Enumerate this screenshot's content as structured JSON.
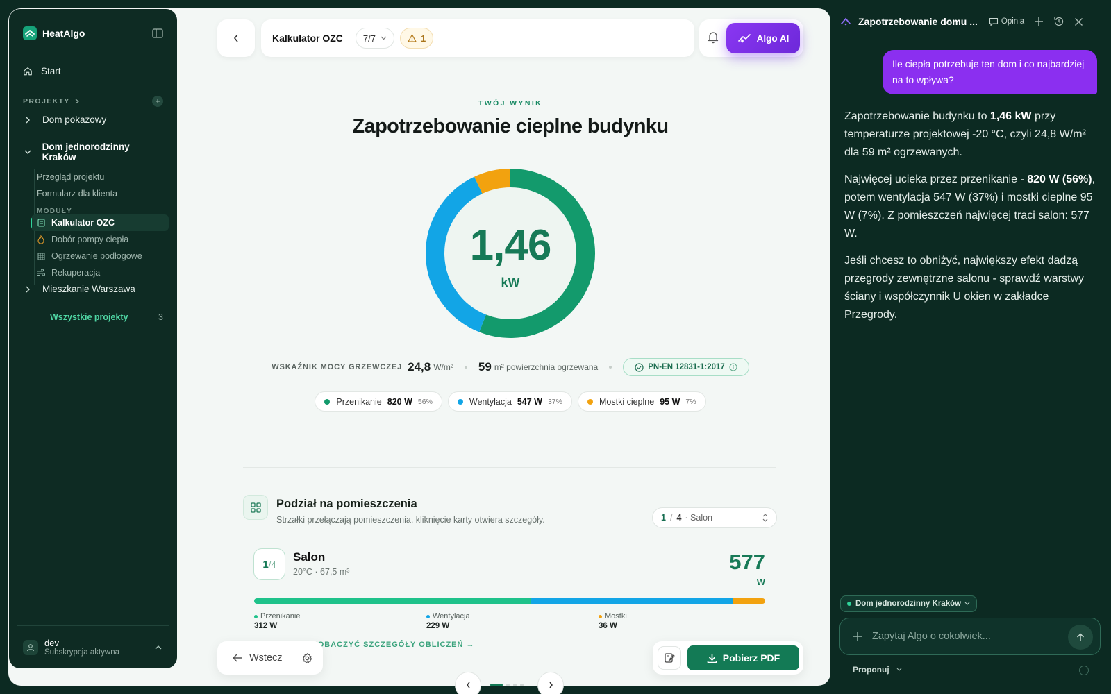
{
  "app": {
    "brand": "HeatAlgo",
    "accent": "#137a55"
  },
  "sidebar": {
    "start_label": "Start",
    "projects_label": "PROJEKTY",
    "projects": [
      {
        "label": "Dom pokazowy"
      },
      {
        "label": "Dom jednorodzinny Kraków"
      },
      {
        "label": "Mieszkanie Warszawa"
      }
    ],
    "sub_items": [
      {
        "label": "Przegląd projektu"
      },
      {
        "label": "Formularz dla klienta"
      }
    ],
    "modules_label": "MODUŁY",
    "modules": [
      {
        "label": "Kalkulator OZC",
        "icon": "calculator-icon",
        "active": true
      },
      {
        "label": "Dobór pompy ciepła",
        "icon": "flame-icon"
      },
      {
        "label": "Ogrzewanie podłogowe",
        "icon": "grid-icon"
      },
      {
        "label": "Rekuperacja",
        "icon": "wind-icon"
      }
    ],
    "all_projects_label": "Wszystkie projekty",
    "all_projects_count": "3",
    "user": {
      "name": "dev",
      "status": "Subskrypcja aktywna"
    }
  },
  "topbar": {
    "title": "Kalkulator OZC",
    "step": "7/7",
    "warnings": "1",
    "ai_button": "Algo AI"
  },
  "result": {
    "eyebrow": "TWÓJ WYNIK",
    "title": "Zapotrzebowanie cieplne budynku",
    "value": "1,46",
    "unit": "kW",
    "indicator_label": "WSKAŹNIK MOCY GRZEWCZEJ",
    "indicator_value": "24,8",
    "indicator_unit": "W/m²",
    "area_value": "59",
    "area_label": "m² powierzchnia ogrzewana",
    "standard": "PN-EN 12831-1:2017",
    "breakdown": [
      {
        "name": "Przenikanie",
        "value": "820 W",
        "pct": "56%",
        "share": 56,
        "color": "#139a6c"
      },
      {
        "name": "Wentylacja",
        "value": "547 W",
        "pct": "37%",
        "share": 37,
        "color": "#12a5e6"
      },
      {
        "name": "Mostki cieplne",
        "value": "95 W",
        "pct": "7%",
        "share": 7,
        "color": "#f2a20f"
      }
    ]
  },
  "rooms": {
    "title": "Podział na pomieszczenia",
    "subtitle": "Strzałki przełączają pomieszczenia, kliknięcie karty otwiera szczegóły.",
    "selector_current": "1",
    "selector_sep": "/",
    "selector_total": "4",
    "selector_name": "· Salon",
    "room": {
      "index": "1",
      "total": "/4",
      "name": "Salon",
      "meta": "20°C · 67,5 m³",
      "power": "577",
      "unit": "W",
      "parts": [
        {
          "name": "Przenikanie",
          "value": "312 W",
          "watts": 312,
          "color": "#1ec28a"
        },
        {
          "name": "Wentylacja",
          "value": "229 W",
          "watts": 229,
          "color": "#12a5e6"
        },
        {
          "name": "Mostki",
          "value": "36 W",
          "watts": 36,
          "color": "#f2a20f"
        }
      ]
    },
    "details_link": "ZOBACZYĆ SZCZEGÓŁY OBLICZEŃ →"
  },
  "footer": {
    "back_label": "Wstecz",
    "pdf_label": "Pobierz PDF"
  },
  "chat": {
    "title": "Zapotrzebowanie domu ...",
    "feedback_label": "Opinia",
    "user_message": "Ile ciepła potrzebuje ten dom i co najbardziej na to wpływa?",
    "p1": {
      "t1": "Zapotrzebowanie budynku to ",
      "b1": "1,46 kW",
      "t2": " przy temperaturze projektowej -20 °C, czyli 24,8 W/m² dla 59 m² ogrzewanych."
    },
    "p2": {
      "t1": "Najwięcej ucieka przez przenikanie - ",
      "b1": "820 W (56%)",
      "t2": ", potem wentylacja 547 W (37%) i mostki cieplne 95 W (7%). Z pomieszczeń najwięcej traci salon: 577 W."
    },
    "p3": "Jeśli chcesz to obniżyć, największy efekt dadzą przegrody zewnętrzne salonu - sprawdź warstwy ściany i współczynnik U okien w zakładce Przegrody.",
    "context_chip": "Dom jednorodzinny Kraków",
    "input_placeholder": "Zapytaj Algo o cokolwiek...",
    "suggest_label": "Proponuj"
  }
}
